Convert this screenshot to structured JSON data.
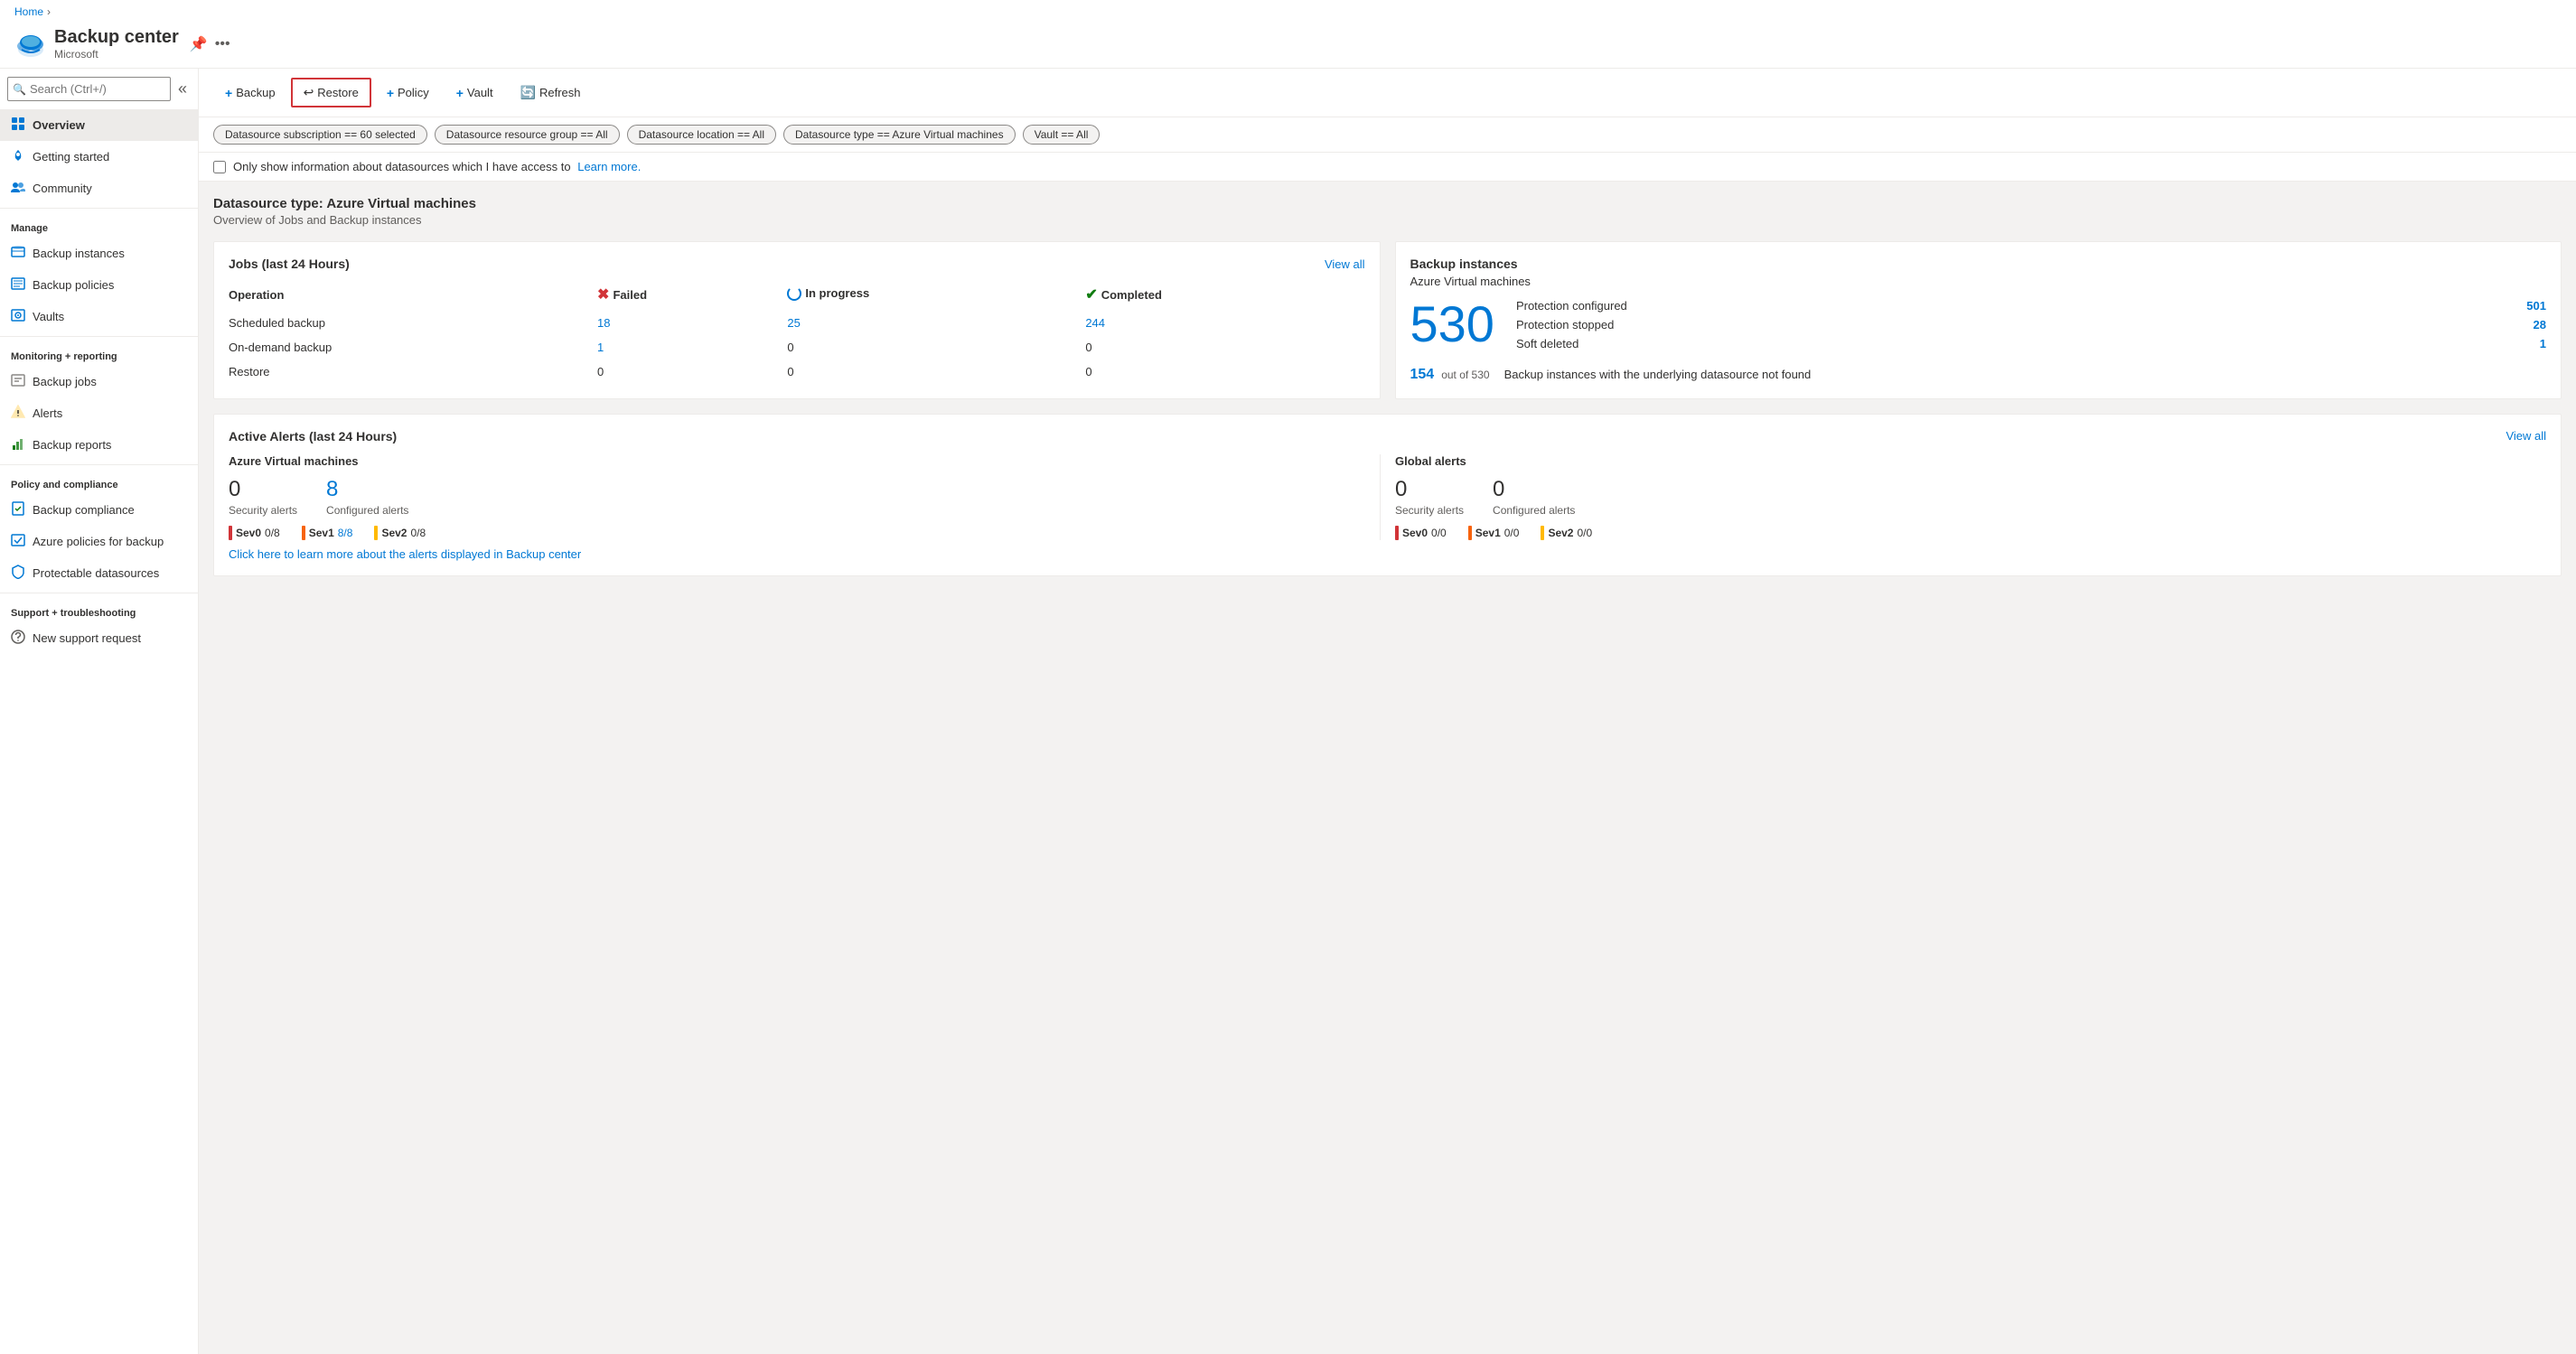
{
  "app": {
    "title": "Backup center",
    "subtitle": "Microsoft",
    "breadcrumb": [
      "Home"
    ]
  },
  "search": {
    "placeholder": "Search (Ctrl+/)"
  },
  "sidebar": {
    "items": [
      {
        "id": "overview",
        "label": "Overview",
        "icon": "grid",
        "active": true,
        "section": null
      },
      {
        "id": "getting-started",
        "label": "Getting started",
        "icon": "rocket",
        "active": false,
        "section": null
      },
      {
        "id": "community",
        "label": "Community",
        "icon": "people",
        "active": false,
        "section": null
      },
      {
        "id": "manage-label",
        "label": "Manage",
        "type": "section"
      },
      {
        "id": "backup-instances",
        "label": "Backup instances",
        "icon": "database",
        "active": false,
        "section": "Manage"
      },
      {
        "id": "backup-policies",
        "label": "Backup policies",
        "icon": "table",
        "active": false,
        "section": "Manage"
      },
      {
        "id": "vaults",
        "label": "Vaults",
        "icon": "vault",
        "active": false,
        "section": "Manage"
      },
      {
        "id": "monitoring-label",
        "label": "Monitoring + reporting",
        "type": "section"
      },
      {
        "id": "backup-jobs",
        "label": "Backup jobs",
        "icon": "jobs",
        "active": false,
        "section": "Monitoring"
      },
      {
        "id": "alerts",
        "label": "Alerts",
        "icon": "alert",
        "active": false,
        "section": "Monitoring"
      },
      {
        "id": "backup-reports",
        "label": "Backup reports",
        "icon": "reports",
        "active": false,
        "section": "Monitoring"
      },
      {
        "id": "policy-label",
        "label": "Policy and compliance",
        "type": "section"
      },
      {
        "id": "backup-compliance",
        "label": "Backup compliance",
        "icon": "compliance",
        "active": false,
        "section": "Policy"
      },
      {
        "id": "azure-policies",
        "label": "Azure policies for backup",
        "icon": "policy",
        "active": false,
        "section": "Policy"
      },
      {
        "id": "protectable",
        "label": "Protectable datasources",
        "icon": "protect",
        "active": false,
        "section": "Policy"
      },
      {
        "id": "support-label",
        "label": "Support + troubleshooting",
        "type": "section"
      },
      {
        "id": "new-support",
        "label": "New support request",
        "icon": "support",
        "active": false,
        "section": "Support"
      }
    ]
  },
  "toolbar": {
    "backup_label": "Backup",
    "restore_label": "Restore",
    "policy_label": "Policy",
    "vault_label": "Vault",
    "refresh_label": "Refresh"
  },
  "filters": [
    {
      "label": "Datasource subscription == 60 selected"
    },
    {
      "label": "Datasource resource group == All"
    },
    {
      "label": "Datasource location == All"
    },
    {
      "label": "Datasource type == Azure Virtual machines"
    },
    {
      "label": "Vault == All"
    }
  ],
  "checkbox": {
    "label": "Only show information about datasources which I have access to",
    "learn_more": "Learn more."
  },
  "datasource": {
    "title": "Datasource type: Azure Virtual machines",
    "subtitle": "Overview of Jobs and Backup instances"
  },
  "jobs_card": {
    "title": "Jobs (last 24 Hours)",
    "view_all": "View all",
    "columns": {
      "operation": "Operation",
      "failed": "Failed",
      "in_progress": "In progress",
      "completed": "Completed"
    },
    "rows": [
      {
        "operation": "Scheduled backup",
        "failed": "18",
        "failed_link": true,
        "in_progress": "25",
        "ip_link": true,
        "completed": "244",
        "comp_link": true
      },
      {
        "operation": "On-demand backup",
        "failed": "1",
        "failed_link": true,
        "in_progress": "0",
        "ip_link": false,
        "completed": "0",
        "comp_link": false
      },
      {
        "operation": "Restore",
        "failed": "0",
        "failed_link": false,
        "in_progress": "0",
        "ip_link": false,
        "completed": "0",
        "comp_link": false
      }
    ]
  },
  "backup_instances_card": {
    "title": "Backup instances",
    "subtitle": "Azure Virtual machines",
    "total": "530",
    "stats": [
      {
        "label": "Protection configured",
        "value": "501"
      },
      {
        "label": "Protection stopped",
        "value": "28"
      },
      {
        "label": "Soft deleted",
        "value": "1"
      }
    ],
    "footer_num": "154",
    "footer_sub": "out of 530",
    "footer_desc": "Backup instances with the underlying datasource not found"
  },
  "alerts_card": {
    "title": "Active Alerts (last 24 Hours)",
    "view_all": "View all",
    "azure_section": {
      "title": "Azure Virtual machines",
      "security_count": "0",
      "security_label": "Security alerts",
      "configured_count": "8",
      "configured_label": "Configured alerts",
      "sevs": [
        {
          "label": "Sev0",
          "value": "0/8",
          "color": "red"
        },
        {
          "label": "Sev1",
          "value": "8/8",
          "color": "orange",
          "highlight": true
        },
        {
          "label": "Sev2",
          "value": "0/8",
          "color": "yellow"
        }
      ]
    },
    "global_section": {
      "title": "Global alerts",
      "security_count": "0",
      "security_label": "Security alerts",
      "configured_count": "0",
      "configured_label": "Configured alerts",
      "sevs": [
        {
          "label": "Sev0",
          "value": "0/0",
          "color": "red"
        },
        {
          "label": "Sev1",
          "value": "0/0",
          "color": "orange"
        },
        {
          "label": "Sev2",
          "value": "0/0",
          "color": "yellow"
        }
      ]
    },
    "learn_more_link": "Click here to learn more about the alerts displayed in Backup center"
  }
}
